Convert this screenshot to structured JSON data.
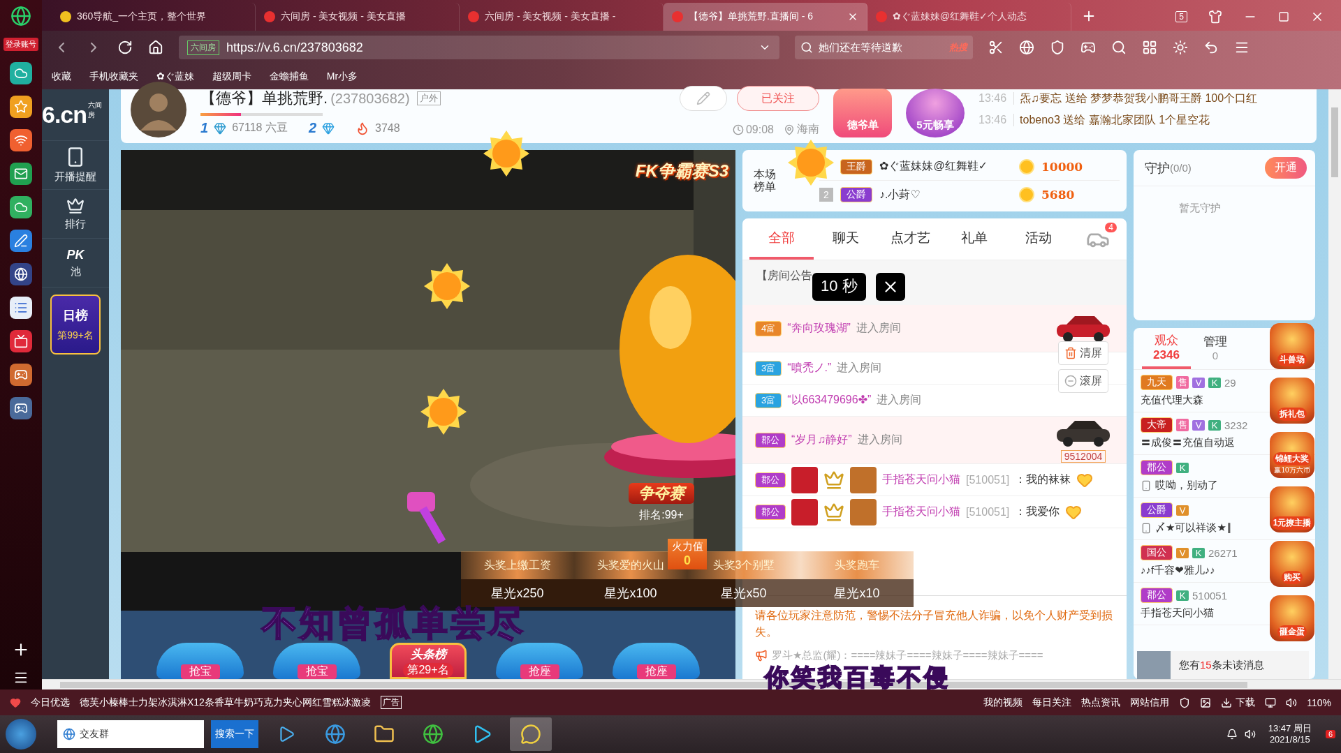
{
  "left_dock": {
    "login_label": "登录账号"
  },
  "browser": {
    "tabs": [
      {
        "label": "360导航_一个主页，整个世界",
        "selected": false
      },
      {
        "label": "六间房 - 美女视频 - 美女直播",
        "selected": false
      },
      {
        "label": "六间房 - 美女视频 - 美女直播 -",
        "selected": false
      },
      {
        "label": "【德爷】单挑荒野.直播间 - 6",
        "selected": true
      },
      {
        "label": "✿ぐ蓝妹妹@红舞鞋✓个人动态",
        "selected": false
      }
    ],
    "tab_count": "5",
    "address": {
      "site_tag": "六间房",
      "url": "https://v.6.cn/237803682"
    },
    "search": {
      "value": "她们还在等待道歉",
      "hot_label": "热搜"
    },
    "bookmarks": [
      "收藏",
      "手机收藏夹",
      "✿ぐ蓝妹",
      "超级周卡",
      "金蟾捕鱼",
      "Mr小多"
    ]
  },
  "site_sidebar": {
    "logo": {
      "mark": "6.cn",
      "name": "六间房"
    },
    "items": [
      {
        "kind": "phone",
        "label": "开播提醒"
      },
      {
        "kind": "crown",
        "label": "排行"
      },
      {
        "kind": "pk",
        "mark": "PK",
        "label": "池"
      }
    ],
    "daily_rank": {
      "title": "日榜",
      "rank": "第99+名"
    }
  },
  "header": {
    "title": "【德爷】单挑荒野.",
    "room_id": "(237803682)",
    "tag": "户外",
    "level": 0.33,
    "rich_level": "1",
    "beans": "67118 六豆",
    "star_level": "2",
    "heat": "3748",
    "follow": "已关注",
    "time": "09:08",
    "location": "海南",
    "promos": [
      "德爷单",
      "5元畅享"
    ],
    "gifts": [
      {
        "time": "13:46",
        "sender": "炁♫要忘",
        "verb": "送给",
        "receiver": "梦梦恭贺我小鹏哥王爵",
        "item": "100个口红"
      },
      {
        "time": "13:46",
        "sender": "tobeno3",
        "verb": "送给",
        "receiver": "嘉瀚北家团队",
        "item": "1个星空花"
      }
    ]
  },
  "video": {
    "logo": "FK争霸赛S3",
    "contest": {
      "title": "争夺赛",
      "rank": "排名:99+"
    },
    "prizes": [
      {
        "top": "头奖上缴工资",
        "reward": "星光x250"
      },
      {
        "top": "头奖爱的火山",
        "reward": "星光x100"
      },
      {
        "top": "头奖3个别墅",
        "reward": "星光x50"
      },
      {
        "top": "头奖跑车",
        "reward": "星光x10"
      }
    ],
    "fire": {
      "label": "火力值",
      "value": "0"
    },
    "seats": [
      {
        "kind": "treasure",
        "label": "抢宝"
      },
      {
        "kind": "treasure",
        "label": "抢宝"
      },
      {
        "kind": "headline",
        "title": "头条榜",
        "label": "第29+名"
      },
      {
        "kind": "seat",
        "label": "抢座"
      },
      {
        "kind": "seat",
        "label": "抢座"
      }
    ]
  },
  "lyrics": [
    "不知曾孤单尝尽",
    "你笑我百毒不侵"
  ],
  "ranking": {
    "title": "本场榜单",
    "rows": [
      {
        "badge": "王爵",
        "color": "#c8641e",
        "name": "✿ぐ蓝妹妹@红舞鞋✓",
        "score": "10000"
      },
      {
        "place": "2",
        "badge": "公爵",
        "color": "#8a3ccf",
        "name": "♪.小葑♡",
        "score": "5680"
      }
    ]
  },
  "chat": {
    "tabs": [
      {
        "label": "全部",
        "selected": true
      },
      {
        "label": "聊天",
        "selected": false
      },
      {
        "label": "点才艺",
        "selected": false
      },
      {
        "label": "礼单",
        "selected": false
      },
      {
        "label": "活动",
        "selected": false
      }
    ],
    "car_count": "4",
    "announcement": "【房间公告",
    "countdown": "10 秒",
    "messages": [
      {
        "kind": "enter",
        "badge": "4富",
        "color": "#e8862a",
        "name": "“奔向玫瑰湖”",
        "text": "进入房间",
        "highlighted": true,
        "car": true
      },
      {
        "kind": "enter",
        "badge": "3富",
        "color": "#2aa3e0",
        "name": "“噴禿ノ.”",
        "text": "进入房间",
        "highlighted": false,
        "car": false
      },
      {
        "kind": "enter",
        "badge": "3富",
        "color": "#2aa3e0",
        "name": "“以663479696✤”",
        "text": "进入房间",
        "highlighted": false,
        "car": false
      },
      {
        "kind": "enter",
        "badge": "郡公",
        "color": "#b03cc8",
        "name": "“岁月♫静好”",
        "text": "进入房间",
        "highlighted": true,
        "car": true,
        "car_number": "9512004"
      },
      {
        "kind": "say",
        "badge": "郡公",
        "color": "#b03cc8",
        "name": "手指苍天问小猫",
        "uid": "[510051]",
        "text": "：我的袜袜"
      },
      {
        "kind": "say",
        "badge": "郡公",
        "color": "#b03cc8",
        "name": "手指苍天问小猫",
        "uid": "[510051]",
        "text": "：我爱你"
      }
    ],
    "clear_button": "清屏",
    "scroll_button": "滚屏",
    "warning": "请各位玩家注意防范，警惕不法分子冒充他人诈骗，以免个人财产受到损失。",
    "broadcast": "罗斗★总监(耀)：====辣妹子====辣妹子====辣妹子===="
  },
  "guard": {
    "title": "守护",
    "count": "(0/0)",
    "open_button": "开通",
    "empty": "暂无守护"
  },
  "audience": {
    "tabs": [
      {
        "label": "观众",
        "count": "2346",
        "selected": true
      },
      {
        "label": "管理",
        "count": "0",
        "selected": false
      }
    ],
    "viewers": [
      {
        "tag": "九天",
        "color": "#e07a20",
        "badges": [
          {
            "label": "售",
            "color": "#f06aa0"
          },
          {
            "label": "V",
            "color": "#a070e0"
          },
          {
            "label": "K",
            "color": "#40b080"
          }
        ],
        "number": "29",
        "name": "充值代理大森",
        "mobile": false
      },
      {
        "tag": "大帝",
        "color": "#c82020",
        "badges": [
          {
            "label": "售",
            "color": "#f06aa0"
          },
          {
            "label": "V",
            "color": "#a070e0"
          },
          {
            "label": "K",
            "color": "#40b080"
          }
        ],
        "number": "3232",
        "name": "〓成俊〓充值自动返",
        "mobile": false
      },
      {
        "tag": "郡公",
        "color": "#b03cc8",
        "badges": [
          {
            "label": "K",
            "color": "#40b080"
          }
        ],
        "name": "哎呦，别动了",
        "mobile": true
      },
      {
        "tag": "公爵",
        "color": "#8a3ccf",
        "badges": [
          {
            "label": "V",
            "color": "#e0902a"
          }
        ],
        "name": "〆★可以祥谈★∥",
        "mobile": true
      },
      {
        "tag": "国公",
        "color": "#d03050",
        "badges": [
          {
            "label": "V",
            "color": "#e0902a"
          },
          {
            "label": "K",
            "color": "#40b080"
          }
        ],
        "number": "26271",
        "name": "♪♪f千容❤雅儿♪♪",
        "mobile": false
      },
      {
        "tag": "郡公",
        "color": "#b03cc8",
        "badges": [
          {
            "label": "K",
            "color": "#40b080"
          }
        ],
        "number": "510051",
        "name": "手指苍天问小猫",
        "mobile": false
      }
    ]
  },
  "promotions": [
    {
      "label": "斗兽场"
    },
    {
      "label": "拆礼包"
    },
    {
      "label": "锦鲤大奖",
      "sub": "赢10万六币"
    },
    {
      "label": "1元撩主播"
    },
    {
      "label": "购买"
    },
    {
      "label": "砸金蛋"
    }
  ],
  "toast": {
    "prefix": "您有",
    "count": "15",
    "suffix": "条未读消息"
  },
  "status_bar": {
    "left_label": "今日优选",
    "ad_text": "德芙小榛棒士力架冰淇淋X12条香草牛奶巧克力夹心网红雪糕冰激凌",
    "ad_tag": "广告",
    "links": [
      "我的视频",
      "每日关注",
      "热点资讯",
      "网站信用"
    ],
    "download": "下载",
    "zoom": "110%"
  },
  "taskbar": {
    "search_value": "交友群",
    "search_button": "搜索一下",
    "time": "13:47 周日",
    "date": "2021/8/15",
    "notifications": "6"
  }
}
